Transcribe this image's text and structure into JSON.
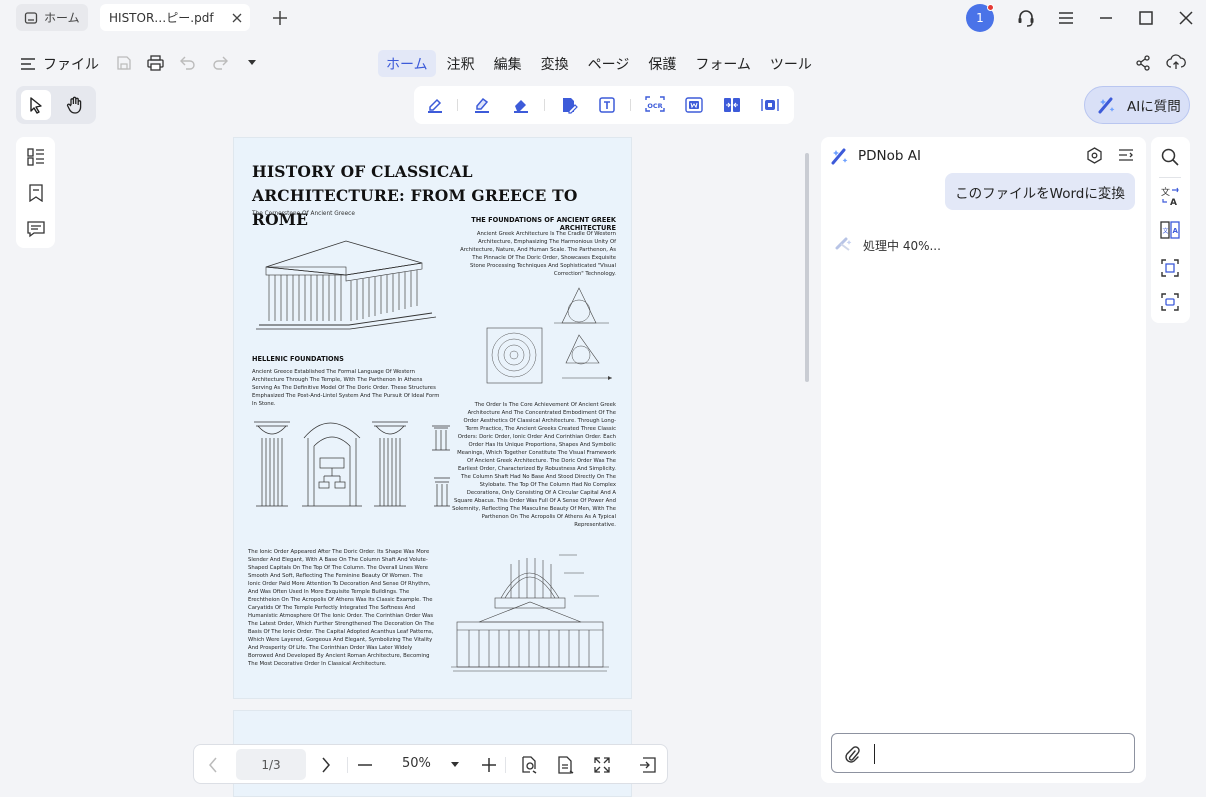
{
  "tabs": {
    "home_label": "ホーム",
    "doc_label": "HISTOR…ピー.pdf"
  },
  "title_bar": {
    "avatar_label": "1"
  },
  "menu": {
    "file_label": "ファイル",
    "items": [
      "ホーム",
      "注釈",
      "編集",
      "変換",
      "ページ",
      "保護",
      "フォーム",
      "ツール"
    ],
    "active_index": 0
  },
  "toolbar": {
    "ai_button_label": "AIに質問",
    "ocr_label": "OCR"
  },
  "document": {
    "title": "HISTORY OF CLASSICAL  ARCHITECTURE: FROM GREECE TO ROME",
    "subtitle": "The Cornerstone Of Ancient Greece",
    "heading_foundations": "THE FOUNDATIONS OF ANCIENT GREEK ARCHITECTURE",
    "para_foundations": "Ancient Greek Architecture Is The Cradle Of Western Architecture, Emphasizing The Harmonious Unity Of Architecture, Nature, And Human Scale. The Parthenon, As The Pinnacle Of The Doric Order, Showcases Exquisite Stone Processing Techniques And Sophisticated \"Visual Correction\" Technology.",
    "heading_hellenic": "HELLENIC FOUNDATIONS",
    "para_hellenic": "Ancient Greece Established The Formal Language Of Western Architecture Through The Temple, With The Parthenon In Athens Serving As The Definitive Model Of The Doric Order. These Structures Emphasized The Post-And-Lintel System And The Pursuit Of Ideal Form In Stone.",
    "para_order": "The Order Is The Core Achievement Of Ancient Greek Architecture And The Concentrated Embodiment Of The Order Aesthetics Of Classical Architecture. Through Long-Term Practice, The Ancient Greeks Created Three Classic Orders: Doric Order, Ionic Order And Corinthian Order. Each Order Has Its Unique Proportions, Shapes And Symbolic Meanings, Which Together Constitute The Visual Framework Of Ancient Greek Architecture. The Doric Order Was The Earliest Order, Characterized By Robustness And Simplicity. The Column Shaft Had No Base And Stood Directly On The Stylobate. The Top Of The Column Had No Complex Decorations, Only Consisting Of A Circular Capital And A Square Abacus. This Order Was Full Of A Sense Of Power And Solemnity, Reflecting The Masculine Beauty Of Men, With The Parthenon On The Acropolis Of Athens As A Typical Representative.",
    "para_ionic": "The Ionic Order Appeared After The Doric Order. Its Shape Was More Slender And Elegant, With A Base On The Column Shaft And Volute-Shaped Capitals On The Top Of The Column. The Overall Lines Were Smooth And Soft, Reflecting The Feminine Beauty Of Women. The Ionic Order Paid More Attention To Decoration And Sense Of Rhythm, And Was Often Used In More Exquisite Temple Buildings. The Erechtheion On The Acropolis Of Athens Was Its Classic Example. The Caryatids Of The Temple Perfectly Integrated The Softness And Humanistic Atmosphere Of The Ionic Order. The Corinthian Order Was The Latest Order, Which Further Strengthened The Decoration On The Basis Of The Ionic Order. The Capital Adopted Acanthus Leaf Patterns, Which Were Layered, Gorgeous And Elegant, Symbolizing The Vitality And Prosperity Of Life. The Corinthian Order Was Later Widely Borrowed And Developed By Ancient Roman Architecture, Becoming The Most Decorative Order In Classical Architecture."
  },
  "pager": {
    "page_indicator": "1/3",
    "zoom": "50%"
  },
  "ai_panel": {
    "title": "PDNob AI",
    "user_message": "このファイルをWordに変換",
    "status": "処理中 40%...",
    "input_value": ""
  },
  "colors": {
    "accent": "#3d5bd9",
    "avatar": "#4a73e8",
    "page_bg": "#eaf3fb"
  }
}
